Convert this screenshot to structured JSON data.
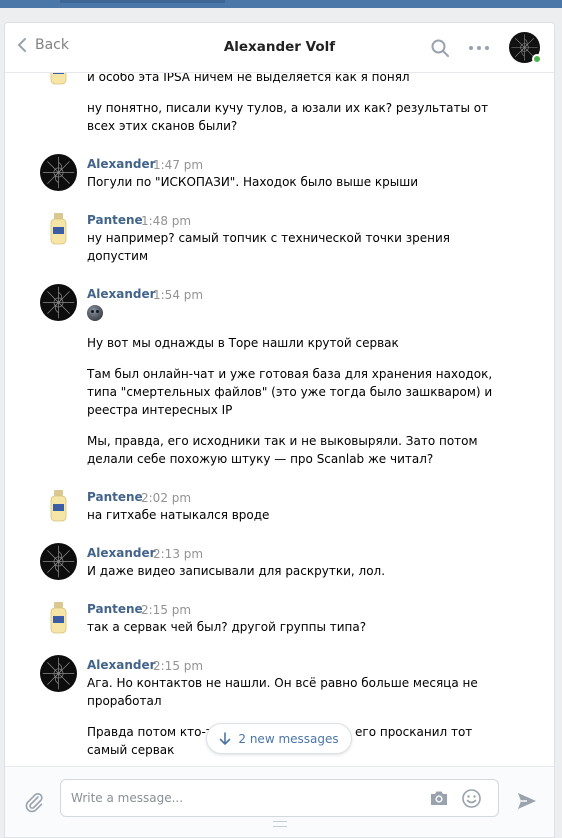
{
  "header": {
    "back_label": "Back",
    "title": "Alexander Volf",
    "icons": [
      "chevron-left-icon",
      "search-icon",
      "more-icon",
      "avatar"
    ]
  },
  "colors": {
    "accent": "#4a76a8",
    "author": "#42648b",
    "online": "#4bb34b",
    "time": "#939393",
    "page_bg": "#edeef0"
  },
  "feed": {
    "top_text": {
      "line1": "и особо эта IPSA ничем не выделяется как я понял",
      "line2": "ну понятно, писали кучу тулов, а юзали их как? результаты от",
      "line3": "всех этих сканов были?"
    },
    "m1": {
      "author": "Alexander",
      "time": "1:47 pm",
      "line1": "Погули по \"ИСКОПАЗИ\". Находок было выше крыши"
    },
    "m2": {
      "author": "Pantene",
      "time": "1:48 pm",
      "line1": "ну например? самый топчик с технической точки зрения",
      "line2": "допустим"
    },
    "m3": {
      "author": "Alexander",
      "time": "1:54 pm",
      "emoji": "neutral-face-emoji",
      "p1": "Ну вот мы однажды в Торе нашли крутой сервак",
      "p2_line1": "Там был онлайн-чат и уже готовая база для хранения находок,",
      "p2_line2": "типа \"смертельных файлов\" (это уже тогда было зашкваром) и",
      "p2_line3": "реестра интересных IP",
      "p3_line1": "Мы, правда, его исходники так и не выковыряли. Зато потом",
      "p3_line2": "делали себе похожую штуку — про Scanlab же читал?"
    },
    "m4": {
      "author": "Pantene",
      "time": "2:02 pm",
      "line1": "на гитхабе натыкался вроде"
    },
    "m5": {
      "author": "Alexander",
      "time": "2:13 pm",
      "line1": "И даже видео записывали для раскрутки, лол."
    },
    "m6": {
      "author": "Pantene",
      "time": "2:15 pm",
      "line1": "так а сервак чей был? другой группы типа?"
    },
    "m7": {
      "author": "Alexander",
      "time": "2:15 pm",
      "line1": "Ага. Но контактов не нашли. Он всё равно больше месяца не",
      "line2": "проработал",
      "line3_left": "Правда потом кто-то",
      "line3_right": "его просканил тот",
      "line4": "самый сервак"
    }
  },
  "new_messages": {
    "label": "2 new messages"
  },
  "composer": {
    "placeholder": "Write a message...",
    "icons": [
      "paperclip-icon",
      "camera-icon",
      "smile-icon",
      "send-icon"
    ]
  }
}
